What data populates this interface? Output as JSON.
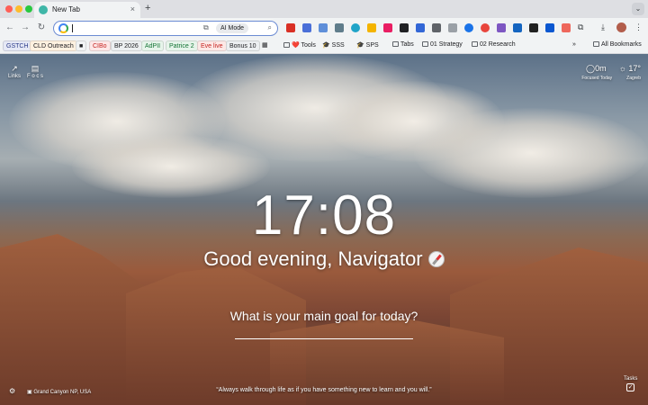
{
  "browser": {
    "tab_title": "New Tab",
    "tab_close": "×",
    "new_tab": "+",
    "tab_menu": "⌄",
    "nav": {
      "back": "←",
      "forward": "→",
      "reload": "↻"
    },
    "omnibox": {
      "ai_mode_label": "AI Mode",
      "search_icon": "⌕",
      "camera_icon": "⧉"
    },
    "toolbar_icons": {
      "download": "⤓",
      "menu": "⋮",
      "puzzle": "⧉"
    }
  },
  "bookmarks": {
    "chips": [
      {
        "label": "GSTCH",
        "color": "#2b3a8a",
        "bg": "#e5e8f5"
      },
      {
        "label": "CLD Outreach",
        "color": "#202124",
        "bg": "#fff1e0"
      },
      {
        "label": "■",
        "color": "#202124",
        "bg": "#f1f3f4"
      },
      {
        "label": "CIBo",
        "color": "#c5221f",
        "bg": "#fde7e7"
      },
      {
        "label": "BP 2026",
        "color": "#202124",
        "bg": "#eceff1"
      },
      {
        "label": "AdPII",
        "color": "#137333",
        "bg": "#e6f4ea"
      },
      {
        "label": "Patrice 2",
        "color": "#137333",
        "bg": "#e6f4ea"
      },
      {
        "label": "Eve live",
        "color": "#c5221f",
        "bg": "#fce8e6"
      },
      {
        "label": "Bonus 10",
        "color": "#202124",
        "bg": "#eceff1"
      }
    ],
    "items": [
      {
        "label": "❤️ Tools"
      },
      {
        "label": "🎓 SSS"
      },
      {
        "label": "🎓 SPS"
      },
      {
        "label": "Tabs"
      },
      {
        "label": "01 Strategy"
      },
      {
        "label": "02 Research"
      }
    ],
    "overflow": "»",
    "all_bookmarks": "All Bookmarks"
  },
  "newtab": {
    "clock": "17:08",
    "greeting": "Good evening, Navigator",
    "prompt": "What is your main goal for today?",
    "links_label": "Links",
    "focus_label": "F o c s",
    "weather": {
      "focus_value": "0m",
      "focus_label": "Focused Today",
      "temp": "17°",
      "city": "Zagreb"
    },
    "quote": "“Always walk through life as if you have something new to learn and you will.”",
    "location": "Grand Canyon NP, USA",
    "tasks_label": "Tasks",
    "tasks_check": "✓"
  }
}
